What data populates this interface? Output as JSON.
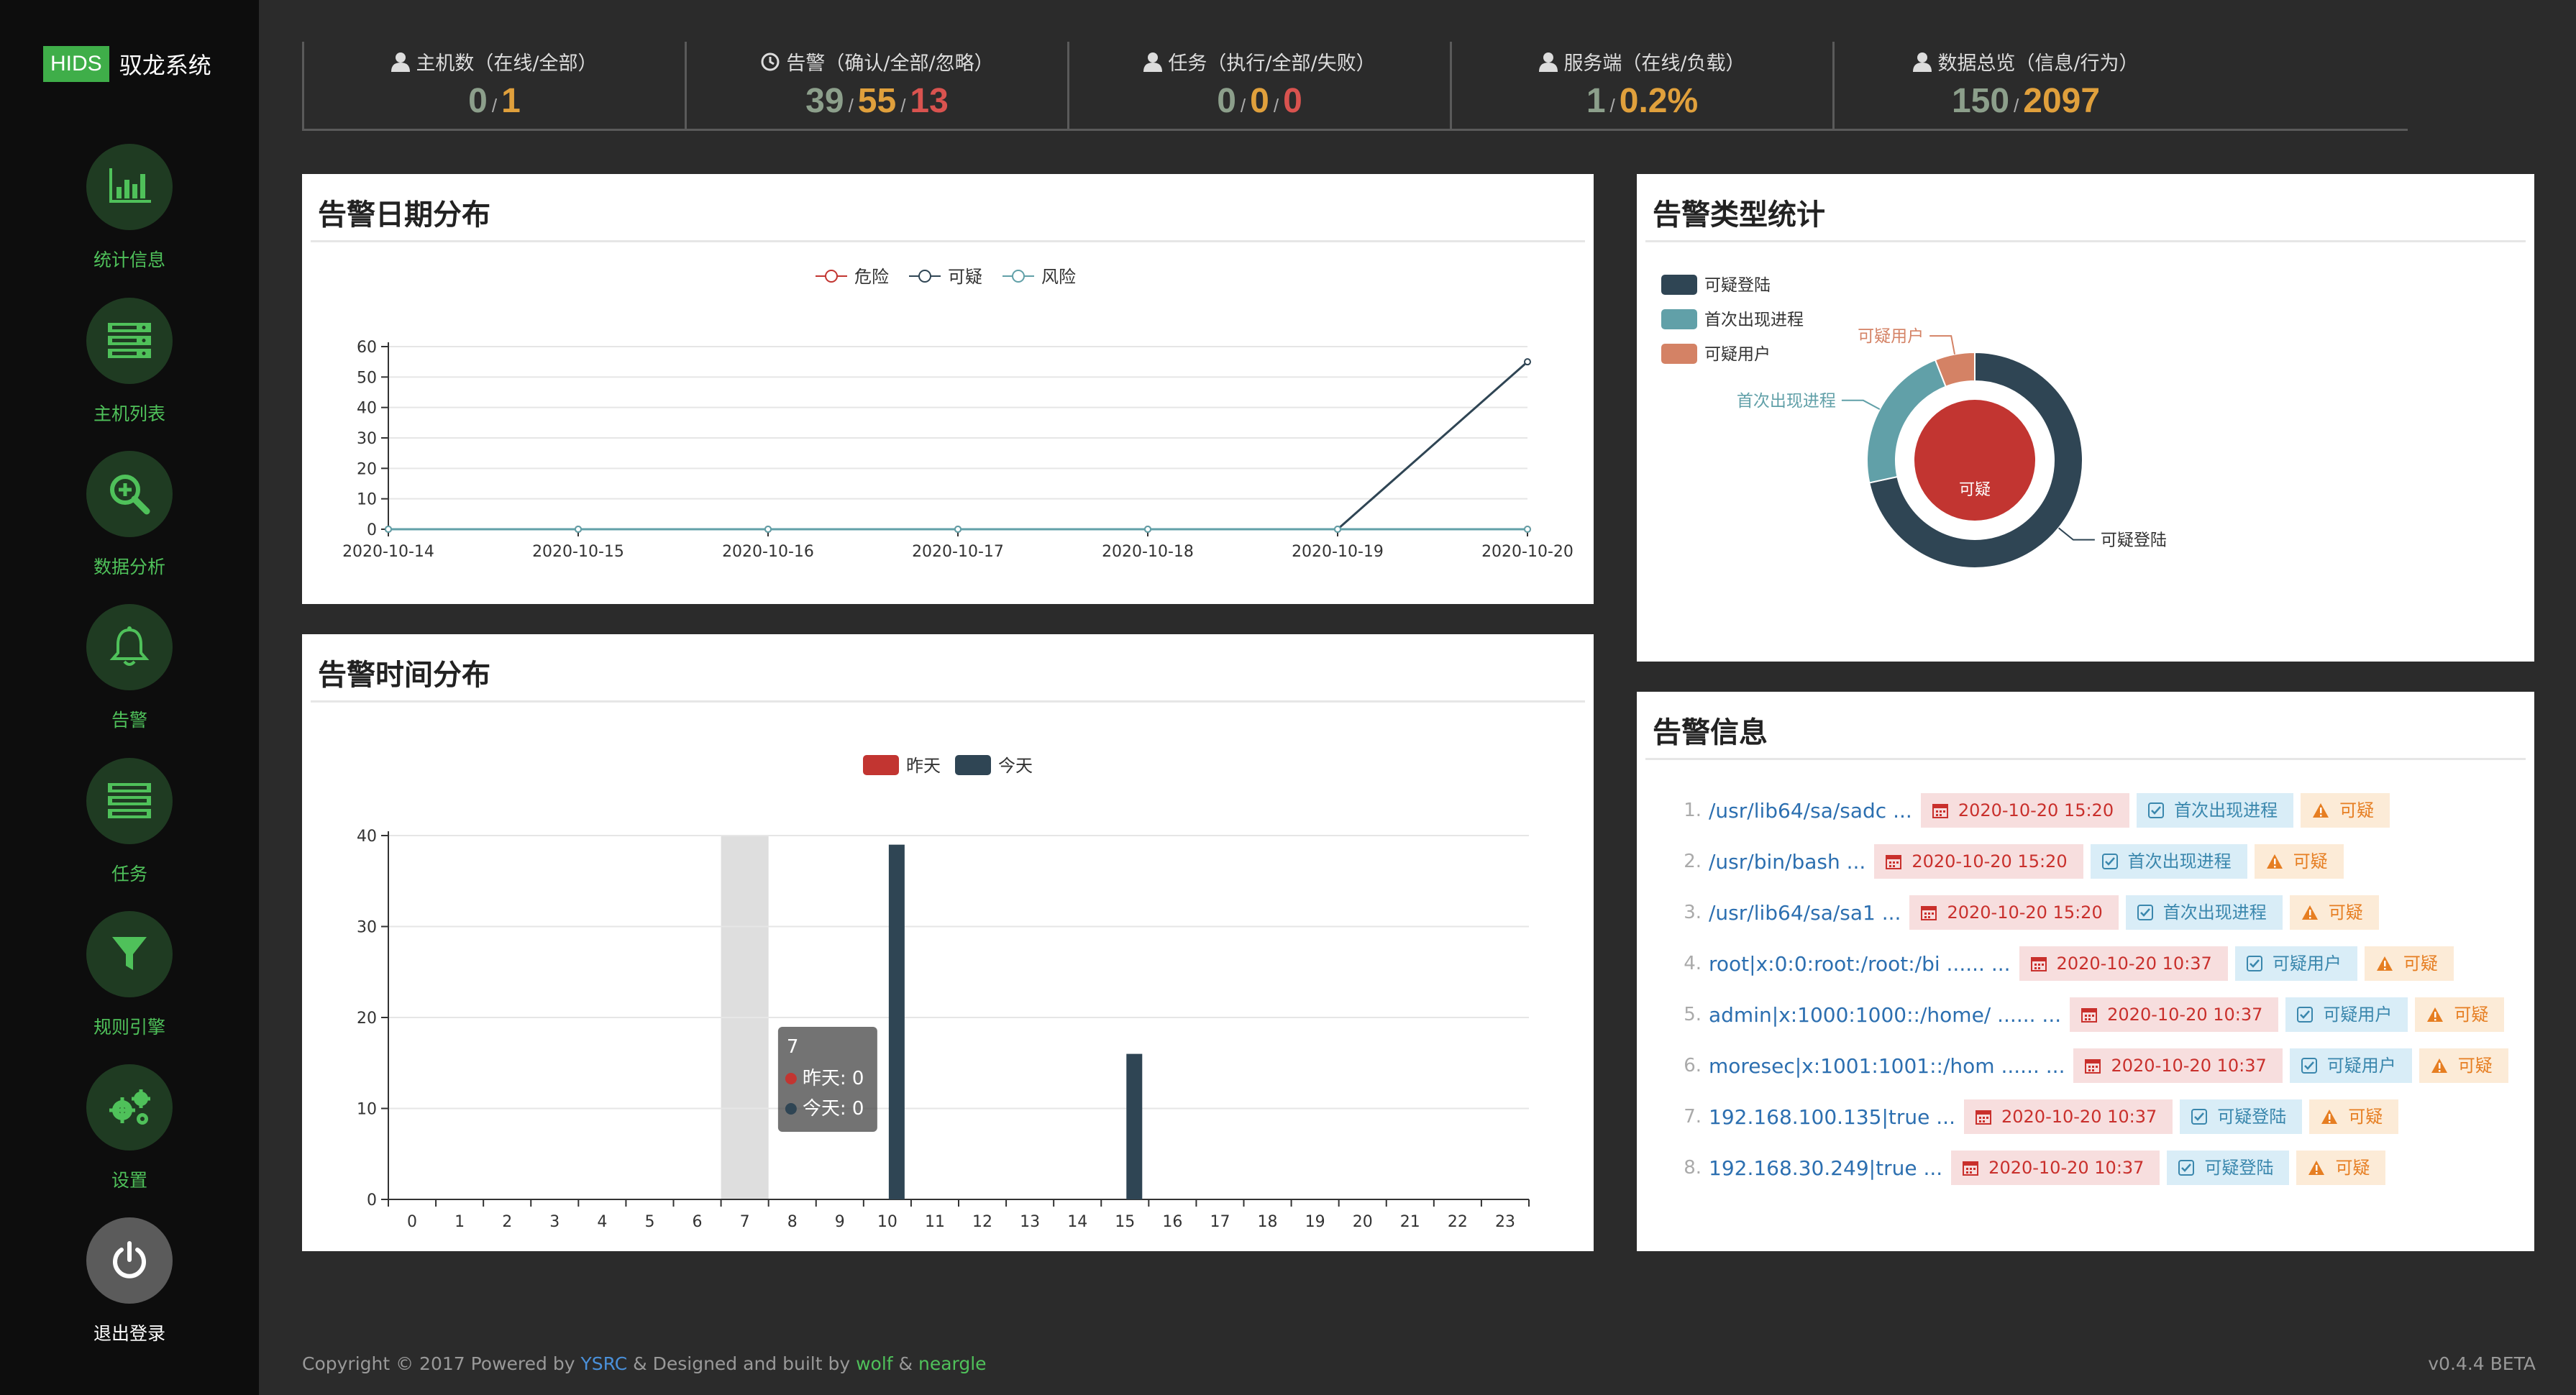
{
  "brand": {
    "tag": "HIDS",
    "name": "驭龙系统"
  },
  "nav": [
    {
      "label": "统计信息",
      "icon": "bar-chart-icon"
    },
    {
      "label": "主机列表",
      "icon": "server-list-icon"
    },
    {
      "label": "数据分析",
      "icon": "zoom-icon"
    },
    {
      "label": "告警",
      "icon": "bell-icon"
    },
    {
      "label": "任务",
      "icon": "task-icon"
    },
    {
      "label": "规则引擎",
      "icon": "filter-icon"
    },
    {
      "label": "设置",
      "icon": "gears-icon"
    },
    {
      "label": "退出登录",
      "icon": "power-icon"
    }
  ],
  "stats": [
    {
      "label": "主机数（在线/全部）",
      "icon": "user-icon",
      "values": [
        "0",
        "1"
      ],
      "colors": [
        "gray",
        "orange"
      ]
    },
    {
      "label": "告警（确认/全部/忽略）",
      "icon": "clock-icon",
      "values": [
        "39",
        "55",
        "13"
      ],
      "colors": [
        "gray",
        "orange",
        "red"
      ]
    },
    {
      "label": "任务（执行/全部/失败）",
      "icon": "user-icon",
      "values": [
        "0",
        "0",
        "0"
      ],
      "colors": [
        "gray",
        "orange",
        "red"
      ]
    },
    {
      "label": "服务端（在线/负载）",
      "icon": "user-icon",
      "values": [
        "1",
        "0.2%"
      ],
      "colors": [
        "gray",
        "orange"
      ]
    },
    {
      "label": "数据总览（信息/行为）",
      "icon": "user-icon",
      "values": [
        "150",
        "2097"
      ],
      "colors": [
        "gray",
        "orange"
      ]
    }
  ],
  "panels": {
    "date_dist": "告警日期分布",
    "time_dist": "告警时间分布",
    "type_stats": "告警类型统计",
    "alert_info": "告警信息"
  },
  "chart_data": [
    {
      "type": "line",
      "title": "告警日期分布",
      "x": [
        "2020-10-14",
        "2020-10-15",
        "2020-10-16",
        "2020-10-17",
        "2020-10-18",
        "2020-10-19",
        "2020-10-20"
      ],
      "ylim": [
        0,
        60
      ],
      "yticks": [
        0,
        10,
        20,
        30,
        40,
        50,
        60
      ],
      "legend_position": "top-center",
      "grid": true,
      "series": [
        {
          "name": "危险",
          "color": "#c23531",
          "values": [
            0,
            0,
            0,
            0,
            0,
            0,
            0
          ]
        },
        {
          "name": "可疑",
          "color": "#2f4554",
          "values": [
            0,
            0,
            0,
            0,
            0,
            0,
            55
          ]
        },
        {
          "name": "风险",
          "color": "#61a0a8",
          "values": [
            0,
            0,
            0,
            0,
            0,
            0,
            0
          ]
        }
      ]
    },
    {
      "type": "bar",
      "title": "告警时间分布",
      "categories": [
        "0",
        "1",
        "2",
        "3",
        "4",
        "5",
        "6",
        "7",
        "8",
        "9",
        "10",
        "11",
        "12",
        "13",
        "14",
        "15",
        "16",
        "17",
        "18",
        "19",
        "20",
        "21",
        "22",
        "23"
      ],
      "ylim": [
        0,
        40
      ],
      "yticks": [
        0,
        10,
        20,
        30,
        40
      ],
      "legend_position": "top-center",
      "grid": true,
      "series": [
        {
          "name": "昨天",
          "color": "#c23531",
          "values": [
            0,
            0,
            0,
            0,
            0,
            0,
            0,
            0,
            0,
            0,
            0,
            0,
            0,
            0,
            0,
            0,
            0,
            0,
            0,
            0,
            0,
            0,
            0,
            0
          ]
        },
        {
          "name": "今天",
          "color": "#2f4554",
          "values": [
            0,
            0,
            0,
            0,
            0,
            0,
            0,
            0,
            0,
            0,
            39,
            0,
            0,
            0,
            0,
            16,
            0,
            0,
            0,
            0,
            0,
            0,
            0,
            0
          ]
        }
      ],
      "tooltip": {
        "title": "7",
        "lines": [
          "昨天: 0",
          "今天: 0"
        ],
        "highlight_category": "7"
      }
    },
    {
      "type": "pie",
      "title": "告警类型统计",
      "legend_position": "top-left",
      "inner": [
        {
          "name": "可疑",
          "value": 55,
          "color": "#c23531"
        }
      ],
      "outer": [
        {
          "name": "可疑登陆",
          "value": 48,
          "color": "#2f4554"
        },
        {
          "name": "首次出现进程",
          "value": 15,
          "color": "#61a0a8"
        },
        {
          "name": "可疑用户",
          "value": 4,
          "color": "#d48265"
        }
      ]
    }
  ],
  "alerts": [
    {
      "idx": "1.",
      "path": "/usr/lib64/sa/sadc ...",
      "time": "2020-10-20 15:20",
      "type": "首次出现进程",
      "level": "可疑"
    },
    {
      "idx": "2.",
      "path": "/usr/bin/bash ...",
      "time": "2020-10-20 15:20",
      "type": "首次出现进程",
      "level": "可疑"
    },
    {
      "idx": "3.",
      "path": "/usr/lib64/sa/sa1 ...",
      "time": "2020-10-20 15:20",
      "type": "首次出现进程",
      "level": "可疑"
    },
    {
      "idx": "4.",
      "path": "root|x:0:0:root:/root:/bi ...... ...",
      "time": "2020-10-20 10:37",
      "type": "可疑用户",
      "level": "可疑"
    },
    {
      "idx": "5.",
      "path": "admin|x:1000:1000::/home/ ...... ...",
      "time": "2020-10-20 10:37",
      "type": "可疑用户",
      "level": "可疑"
    },
    {
      "idx": "6.",
      "path": "moresec|x:1001:1001::/hom ...... ...",
      "time": "2020-10-20 10:37",
      "type": "可疑用户",
      "level": "可疑"
    },
    {
      "idx": "7.",
      "path": "192.168.100.135|true ...",
      "time": "2020-10-20 10:37",
      "type": "可疑登陆",
      "level": "可疑"
    },
    {
      "idx": "8.",
      "path": "192.168.30.249|true ...",
      "time": "2020-10-20 10:37",
      "type": "可疑登陆",
      "level": "可疑"
    }
  ],
  "footer": {
    "prefix": "Copyright © 2017 Powered by",
    "ysrc": "YSRC",
    "middle": "& Designed and built by",
    "wolf": "wolf",
    "amp": "&",
    "neargle": "neargle",
    "version": "v0.4.4 BETA"
  }
}
